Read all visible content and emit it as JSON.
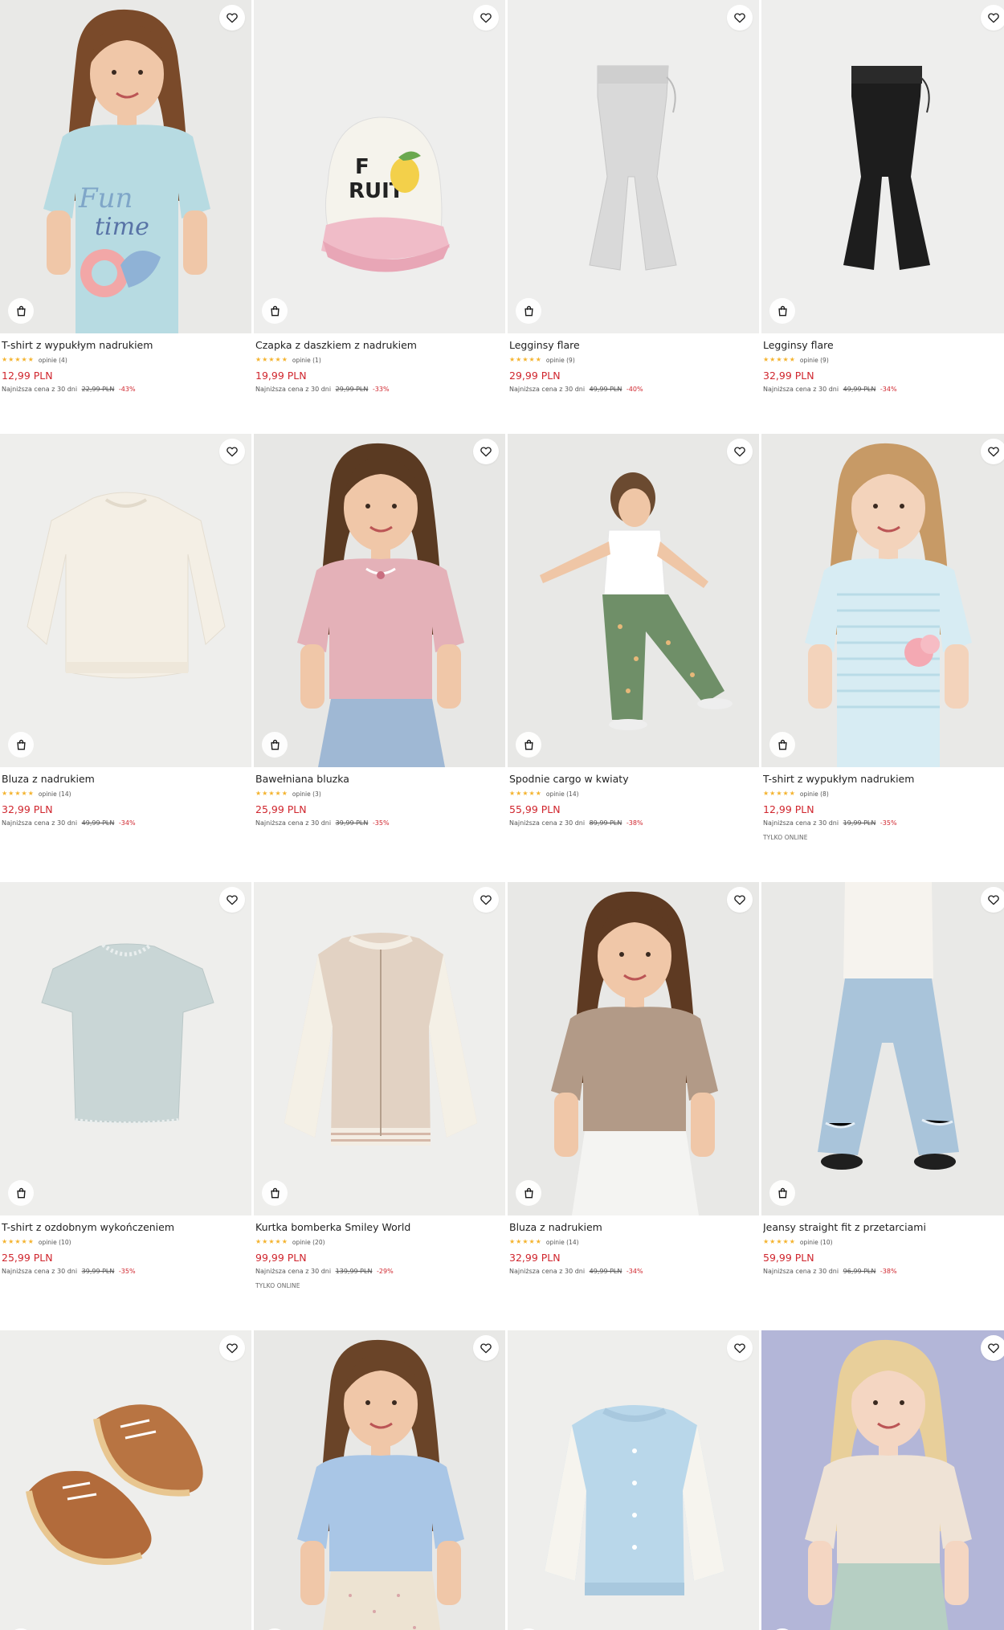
{
  "products": [
    {
      "name": "T-shirt z wypukłym nadrukiem",
      "rating": 5,
      "reviews": "opinie (4)",
      "price": "12,99 PLN",
      "lowest_label": "Najniższa cena z 30 dni",
      "old_price": "22,99 PLN",
      "discount": "-43%",
      "badge": ""
    },
    {
      "name": "Czapka z daszkiem z nadrukiem",
      "rating": 5,
      "reviews": "opinie (1)",
      "price": "19,99 PLN",
      "lowest_label": "Najniższa cena z 30 dni",
      "old_price": "29,99 PLN",
      "discount": "-33%",
      "badge": ""
    },
    {
      "name": "Legginsy flare",
      "rating": 5,
      "reviews": "opinie (9)",
      "price": "29,99 PLN",
      "lowest_label": "Najniższa cena z 30 dni",
      "old_price": "49,99 PLN",
      "discount": "-40%",
      "badge": ""
    },
    {
      "name": "Legginsy flare",
      "rating": 5,
      "reviews": "opinie (9)",
      "price": "32,99 PLN",
      "lowest_label": "Najniższa cena z 30 dni",
      "old_price": "49,99 PLN",
      "discount": "-34%",
      "badge": ""
    },
    {
      "name": "Bluza z nadrukiem",
      "rating": 5,
      "reviews": "opinie (14)",
      "price": "32,99 PLN",
      "lowest_label": "Najniższa cena z 30 dni",
      "old_price": "49,99 PLN",
      "discount": "-34%",
      "badge": ""
    },
    {
      "name": "Bawełniana bluzka",
      "rating": 4.5,
      "reviews": "opinie (3)",
      "price": "25,99 PLN",
      "lowest_label": "Najniższa cena z 30 dni",
      "old_price": "39,99 PLN",
      "discount": "-35%",
      "badge": ""
    },
    {
      "name": "Spodnie cargo w kwiaty",
      "rating": 4.5,
      "reviews": "opinie (14)",
      "price": "55,99 PLN",
      "lowest_label": "Najniższa cena z 30 dni",
      "old_price": "89,99 PLN",
      "discount": "-38%",
      "badge": ""
    },
    {
      "name": "T-shirt z wypukłym nadrukiem",
      "rating": 5,
      "reviews": "opinie (8)",
      "price": "12,99 PLN",
      "lowest_label": "Najniższa cena z 30 dni",
      "old_price": "19,99 PLN",
      "discount": "-35%",
      "badge": "TYLKO ONLINE"
    },
    {
      "name": "T-shirt z ozdobnym wykończeniem",
      "rating": 5,
      "reviews": "opinie (10)",
      "price": "25,99 PLN",
      "lowest_label": "Najniższa cena z 30 dni",
      "old_price": "39,99 PLN",
      "discount": "-35%",
      "badge": ""
    },
    {
      "name": "Kurtka bomberka Smiley World",
      "rating": 5,
      "reviews": "opinie (20)",
      "price": "99,99 PLN",
      "lowest_label": "Najniższa cena z 30 dni",
      "old_price": "139,99 PLN",
      "discount": "-29%",
      "badge": "TYLKO ONLINE"
    },
    {
      "name": "Bluza z nadrukiem",
      "rating": 4.5,
      "reviews": "opinie (14)",
      "price": "32,99 PLN",
      "lowest_label": "Najniższa cena z 30 dni",
      "old_price": "49,99 PLN",
      "discount": "-34%",
      "badge": ""
    },
    {
      "name": "Jeansy straight fit z przetarciami",
      "rating": 5,
      "reviews": "opinie (10)",
      "price": "59,99 PLN",
      "lowest_label": "Najniższa cena z 30 dni",
      "old_price": "96,99 PLN",
      "discount": "-38%",
      "badge": ""
    },
    {
      "name": "",
      "rating": 0,
      "reviews": "",
      "price": "",
      "lowest_label": "",
      "old_price": "",
      "discount": "",
      "badge": ""
    },
    {
      "name": "",
      "rating": 0,
      "reviews": "",
      "price": "",
      "lowest_label": "",
      "old_price": "",
      "discount": "",
      "badge": ""
    },
    {
      "name": "",
      "rating": 0,
      "reviews": "",
      "price": "",
      "lowest_label": "",
      "old_price": "",
      "discount": "",
      "badge": ""
    },
    {
      "name": "",
      "rating": 0,
      "reviews": "",
      "price": "",
      "lowest_label": "",
      "old_price": "",
      "discount": "",
      "badge": ""
    }
  ],
  "images": [
    {
      "subject": "girl-light-blue-tshirt",
      "bg": "#e9e9e7"
    },
    {
      "subject": "trucker-cap",
      "bg": "#eeeeed"
    },
    {
      "subject": "light-grey-flare-leggings",
      "bg": "#eeeeed"
    },
    {
      "subject": "black-flare-leggings",
      "bg": "#eeeeed"
    },
    {
      "subject": "cream-sweatshirt",
      "bg": "#eeeeec"
    },
    {
      "subject": "girl-pink-blouse",
      "bg": "#e7e7e5"
    },
    {
      "subject": "girl-floral-cargo-pants",
      "bg": "#e8e8e6"
    },
    {
      "subject": "girl-striped-tshirt",
      "bg": "#e9e9e7"
    },
    {
      "subject": "light-blue-ruffle-tshirt",
      "bg": "#eeeeec"
    },
    {
      "subject": "beige-bomber-jacket",
      "bg": "#eeeeec"
    },
    {
      "subject": "girl-brown-sweatshirt",
      "bg": "#e8e8e6"
    },
    {
      "subject": "girl-light-jeans",
      "bg": "#e9e9e7"
    },
    {
      "subject": "brown-sneakers",
      "bg": "#eeeeec"
    },
    {
      "subject": "girl-blue-sweater",
      "bg": "#e8e8e6"
    },
    {
      "subject": "light-blue-bomber-jacket",
      "bg": "#eeeeec"
    },
    {
      "subject": "girl-cream-jacket",
      "bg": "#b3b6d8"
    }
  ],
  "icons": {
    "wishlist": "heart-icon",
    "cart": "shopping-bag-icon"
  },
  "colors": {
    "price": "#d0262e",
    "star": "#f4b32e"
  }
}
